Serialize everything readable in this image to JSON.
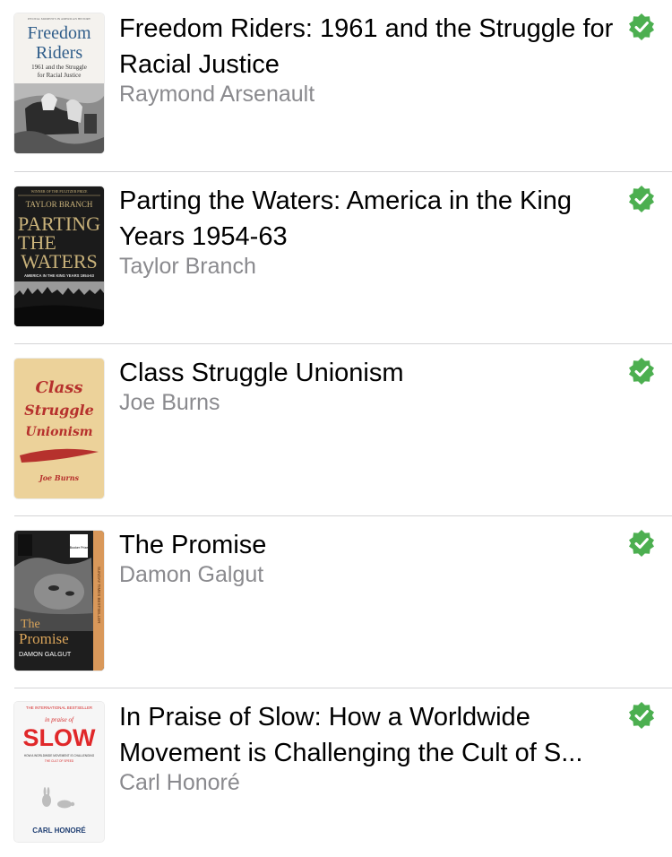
{
  "books": [
    {
      "title": "Freedom Riders: 1961 and the Struggle for Racial Justice",
      "author": "Raymond Arsenault",
      "cover": {
        "kicker": "PIVOTAL MOMENTS IN AMERICAN HISTORY",
        "line1": "Freedom",
        "line2": "Riders",
        "sub1": "1961 and the Struggle",
        "sub2": "for Racial Justice"
      }
    },
    {
      "title": "Parting the Waters: America in the King Years 1954-63",
      "author": "Taylor Branch",
      "cover": {
        "kicker": "WINNER OF THE PULITZER PRIZE",
        "author": "TAYLOR BRANCH",
        "line1": "PARTING",
        "line2": "THE",
        "line3": "WATERS",
        "sub": "AMERICA IN THE KING YEARS 1954-63"
      }
    },
    {
      "title": "Class Struggle Unionism",
      "author": "Joe Burns",
      "cover": {
        "line1": "Class",
        "line2": "Struggle",
        "line3": "Unionism",
        "author": "Joe Burns"
      }
    },
    {
      "title": "The Promise",
      "author": "Damon Galgut",
      "cover": {
        "line1": "The",
        "line2": "Promise",
        "author": "DAMON GALGUT",
        "spine": "SUNDAY TIMES BESTSELLER",
        "badge": "Booker Prize"
      }
    },
    {
      "title": "In Praise of Slow: How a Worldwide Movement is Challenging the Cult of S...",
      "author": "Carl Honoré",
      "cover": {
        "kicker": "THE INTERNATIONAL BESTSELLER",
        "line1": "in praise of",
        "line2": "SLOW",
        "sub1": "HOW A WORLDWIDE MOVEMENT IS CHALLENGING",
        "sub2": "THE CULT OF SPEED",
        "author": "CARL HONORÉ"
      }
    }
  ],
  "colors": {
    "check": "#4caf50",
    "author": "#8a8a8e",
    "separator": "#d4d4d6"
  },
  "icons": {
    "status": "checkmark-seal-icon"
  }
}
